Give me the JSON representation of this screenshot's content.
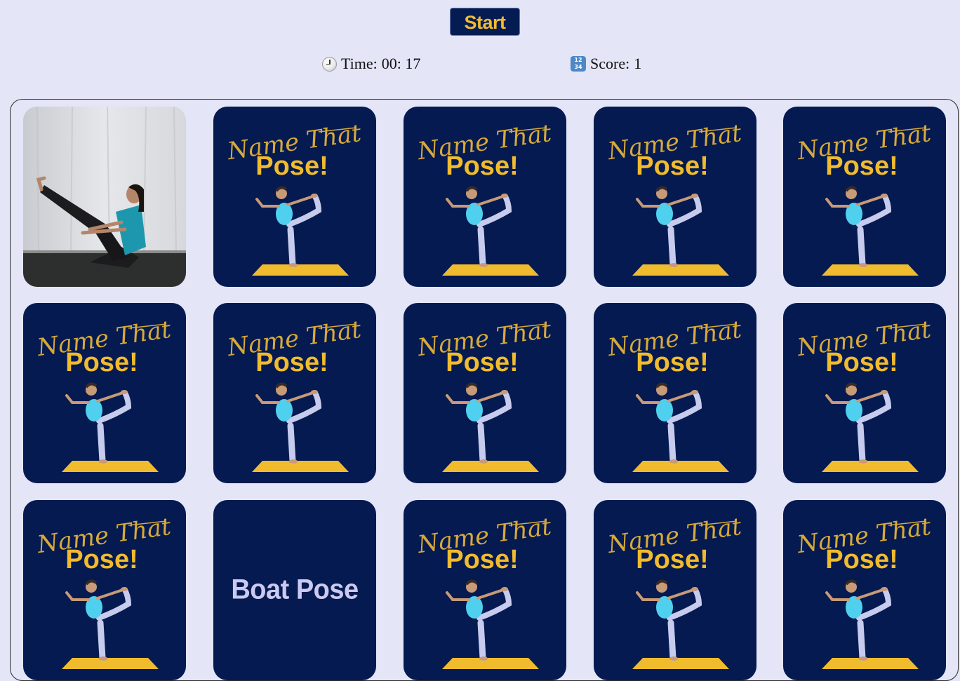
{
  "controls": {
    "start_label": "Start"
  },
  "stats": {
    "time_label": "Time:",
    "time_value": "00: 17",
    "time_icon": "clock-icon",
    "score_label": "Score:",
    "score_value": "1",
    "score_icon": "input-numbers-icon"
  },
  "card_back": {
    "script_title": "Name That",
    "title": "Pose!"
  },
  "colors": {
    "background": "#e4e5f7",
    "card_back": "#041a50",
    "accent_gold": "#f1bb2e",
    "revealed_text": "#cbc9f0"
  },
  "cards": [
    {
      "state": "revealed-photo",
      "pose": "boat pose photo"
    },
    {
      "state": "hidden"
    },
    {
      "state": "hidden"
    },
    {
      "state": "hidden"
    },
    {
      "state": "hidden"
    },
    {
      "state": "hidden"
    },
    {
      "state": "hidden"
    },
    {
      "state": "hidden"
    },
    {
      "state": "hidden"
    },
    {
      "state": "hidden"
    },
    {
      "state": "hidden"
    },
    {
      "state": "revealed-name",
      "label": "Boat Pose"
    },
    {
      "state": "hidden"
    },
    {
      "state": "hidden"
    },
    {
      "state": "hidden"
    }
  ]
}
